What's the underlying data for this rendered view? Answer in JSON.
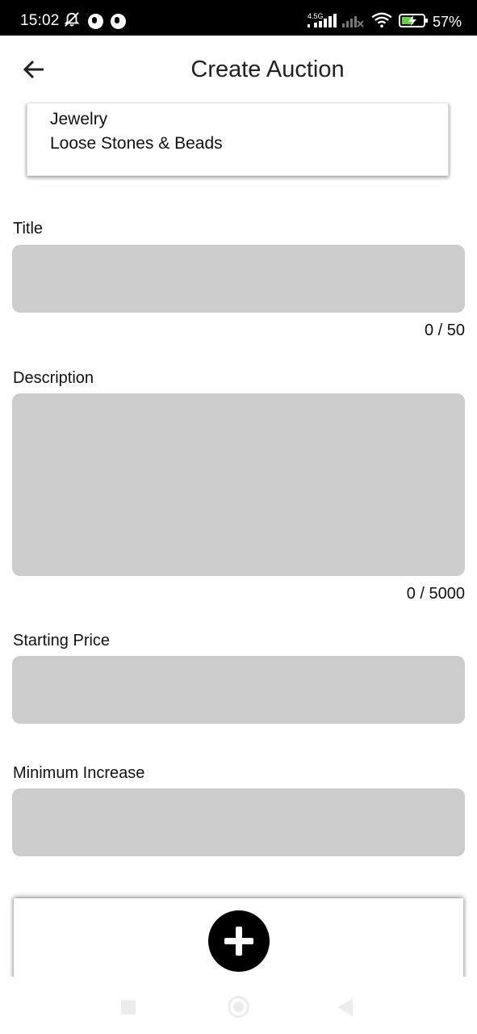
{
  "status_bar": {
    "time": "15:02",
    "network_label": "4.5G",
    "battery_percent": "57%",
    "icons": [
      "muted-bell-icon",
      "app-notification-icon",
      "app-notification-icon",
      "signal-icon",
      "no-signal-icon",
      "wifi-icon",
      "battery-charging-icon"
    ]
  },
  "app_bar": {
    "title": "Create Auction",
    "back_icon": "arrow-left-icon"
  },
  "category_card": {
    "items": [
      "Jewelry",
      "Loose Stones & Beads"
    ]
  },
  "form": {
    "title": {
      "label": "Title",
      "value": "",
      "counter": "0 / 50"
    },
    "description": {
      "label": "Description",
      "value": "",
      "counter": "0 / 5000"
    },
    "starting_price": {
      "label": "Starting Price",
      "value": ""
    },
    "minimum_increase": {
      "label": "Minimum Increase",
      "value": ""
    }
  },
  "add_card": {
    "icon": "plus-icon"
  },
  "nav_bar": {
    "icons": [
      "recents-square-icon",
      "home-circle-icon",
      "back-triangle-icon"
    ]
  },
  "colors": {
    "input_background": "#cccccc",
    "accent": "#000000",
    "status_bar": "#000000"
  }
}
